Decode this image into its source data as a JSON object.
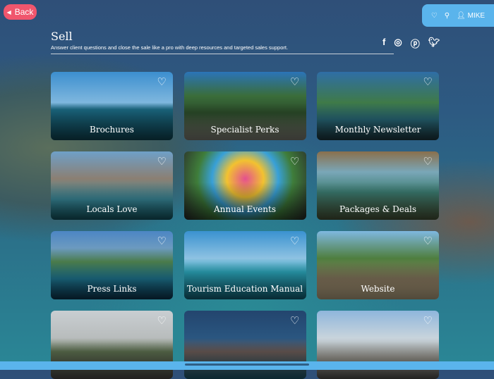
{
  "nav": {
    "back_label": "Back",
    "user_label": "MIKE"
  },
  "header": {
    "title": "Sell",
    "subtitle": "Answer client questions and close the sale like a pro with deep resources and targeted sales support."
  },
  "social": [
    "facebook-icon",
    "instagram-icon",
    "pinterest-icon",
    "twitter-icon"
  ],
  "cards": [
    {
      "label": "Brochures",
      "bg": "linear-gradient(180deg,#3c8fcf 0%,#7fb7de 45%,#1c6c86 55%,#104c5c 100%)"
    },
    {
      "label": "Specialist Perks",
      "bg": "linear-gradient(180deg,#2b74b8 0%,#3a6d3a 35%,#2c4d2a 60%,#8b8a80 100%)"
    },
    {
      "label": "Monthly Newsletter",
      "bg": "linear-gradient(180deg,#2f6ea6 0%,#3f7a48 45%,#2a6d7e 70%,#1d3b44 100%)"
    },
    {
      "label": "Locals Love",
      "bg": "linear-gradient(180deg,#6fa0c8 0%,#8b7f72 40%,#3c8fa0 70%,#155d6a 100%)"
    },
    {
      "label": "Annual Events",
      "bg": "radial-gradient(circle at 50% 40%,#e4508f 0,#f2c230 25%,#38a0d8 45%,#3f7d3a 65%,#2a2a2a 100%)"
    },
    {
      "label": "Packages & Deals",
      "bg": "linear-gradient(180deg,#8a6f4c 0%,#7aa7b8 30%,#3c7d72 60%,#4d5b3c 100%)"
    },
    {
      "label": "Press Links",
      "bg": "linear-gradient(180deg,#4c86c4 0%,#6c9ac0 25%,#4a7b4a 45%,#1f7a96 70%,#0e3c58 100%)"
    },
    {
      "label": "Tourism Education Manual",
      "bg": "linear-gradient(180deg,#3a92d0 0%,#8ec2e2 40%,#2ba4b8 60%,#156c82 100%)"
    },
    {
      "label": "Website",
      "bg": "linear-gradient(180deg,#7fb8e0 0%,#4f7e3e 40%,#8c7c62 70%,#c8b690 100%)"
    },
    {
      "label": "",
      "bg": "linear-gradient(180deg,#c9ced2 0%,#b8bcbc 40%,#5b6e4e 60%,#53504c 100%)"
    },
    {
      "label": "",
      "bg": "linear-gradient(180deg,#23456e 0%,#2a5680 40%,#6a5a55 60%,#1f6076 100%)"
    },
    {
      "label": "",
      "bg": "linear-gradient(180deg,#8fb6dc 0%,#c8d4dc 40%,#9a9890 70%,#5a5854 100%)"
    }
  ]
}
